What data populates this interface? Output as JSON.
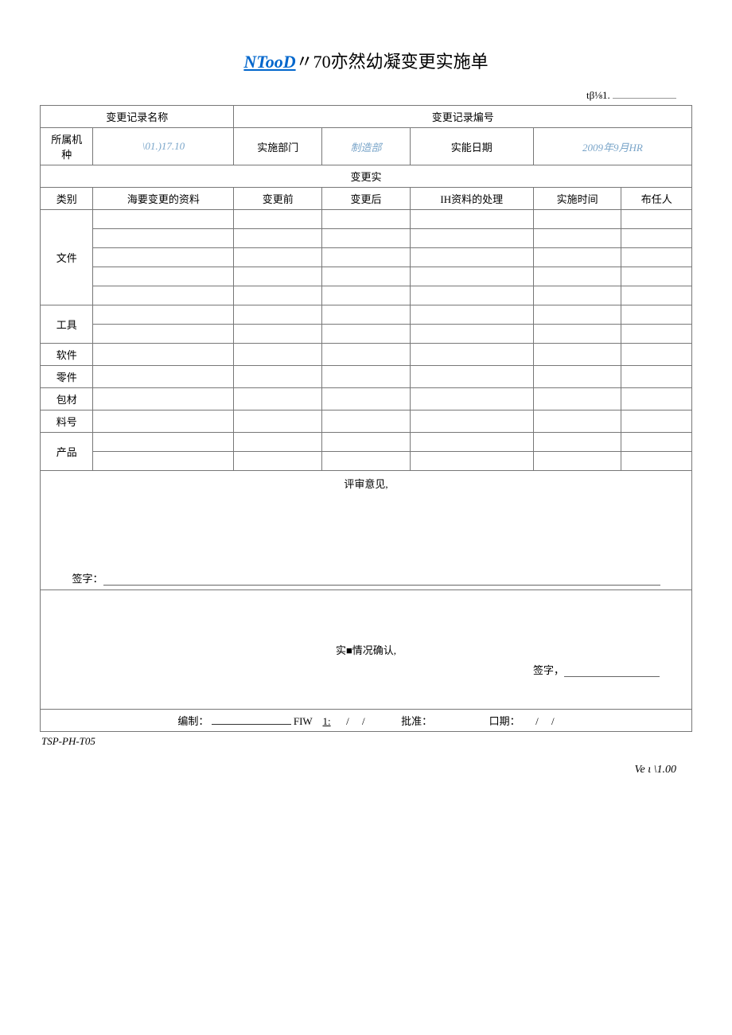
{
  "title": {
    "link": "NTooD",
    "rest": "〃70亦然幼凝变更实施单"
  },
  "top_right": "tβ⅛1.",
  "row1": {
    "label1": "变更记录名称",
    "label2": "变更记录煸号"
  },
  "row2": {
    "label1": "所属机种",
    "val1": "\\01.)17.10",
    "label2": "实施部门",
    "val2": "制造部",
    "label3": "实能日期",
    "val3": "2009年9月HR"
  },
  "section_header": "变更实",
  "cols": {
    "c1": "类别",
    "c2": "海要变更的资料",
    "c3": "变更前",
    "c4": "变更后",
    "c5": "IH资料的处理",
    "c6": "实施时间",
    "c7": "布任人"
  },
  "cats": {
    "file": "文件",
    "tool": "工具",
    "software": "软件",
    "part": "零件",
    "pack": "包材",
    "matno": "料号",
    "product": "产品"
  },
  "review": {
    "label": "评审意见,",
    "sign": "签字："
  },
  "confirm": {
    "label": "实■情况确认,",
    "sign": "签字，"
  },
  "footer": {
    "prep": "编制：",
    "fiw": "FIW",
    "one": "1:",
    "slash1": "/",
    "slash2": "/",
    "approve": "批准：",
    "date": "口期：",
    "slash3": "/",
    "slash4": "/"
  },
  "code": "TSP-PH-T05",
  "ver": "Ve ι \\1.00"
}
